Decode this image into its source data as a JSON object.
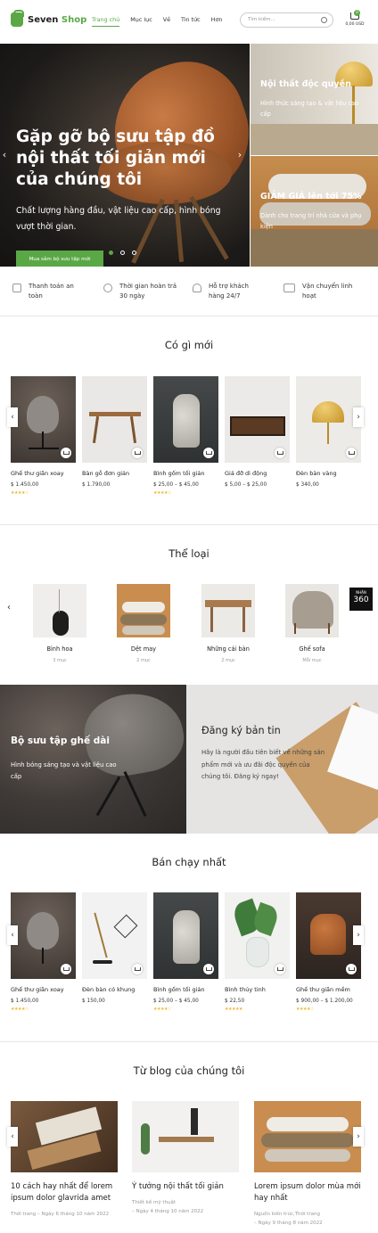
{
  "header": {
    "logo_main": "Seven",
    "logo_accent": "Shop",
    "nav": [
      "Trang chủ",
      "Mục lục",
      "Về",
      "Tin tức",
      "Hơn"
    ],
    "search_placeholder": "Tìm kiếm...",
    "cart_count": "0",
    "cart_total": "0,00 USD"
  },
  "hero": {
    "title": "Gặp gỡ bộ sưu tập đồ nội thất tối giản mới của chúng tôi",
    "subtitle": "Chất lượng hàng đầu, vật liệu cao cấp, hình bóng vượt thời gian.",
    "button": "Mua sắm bộ sưu tập mới",
    "prev": "‹",
    "next": "›"
  },
  "side_banners": [
    {
      "title": "Nội thất độc quyền",
      "subtitle": "Hình thức sáng tạo & vật liệu cao cấp"
    },
    {
      "title": "GIẢM GIÁ lên tới 75%",
      "subtitle": "Dành cho trang trí nhà cửa và phụ kiện"
    }
  ],
  "features": [
    {
      "icon": "payment-icon",
      "text": "Thanh toán an toàn"
    },
    {
      "icon": "return-icon",
      "text": "Thời gian hoàn trả 30 ngày"
    },
    {
      "icon": "support-icon",
      "text": "Hỗ trợ khách hàng 24/7"
    },
    {
      "icon": "truck-icon",
      "text": "Vận chuyển linh hoạt"
    }
  ],
  "new_section": {
    "title": "Có gì mới",
    "products": [
      {
        "name": "Ghế thư giãn xoay",
        "price": "$ 1.450,00",
        "rating": 4
      },
      {
        "name": "Bàn gỗ đơn giản",
        "price": "$ 1.790,00",
        "rating": 0
      },
      {
        "name": "Bình gốm tối giản",
        "price": "$ 25,00 – $ 45,00",
        "rating": 4
      },
      {
        "name": "Giá đỡ di động",
        "price": "$ 5,00 – $ 25,00",
        "rating": 0
      },
      {
        "name": "Đèn bàn vàng",
        "price": "$ 340,00",
        "rating": 0
      }
    ]
  },
  "categories_section": {
    "title": "Thể loại",
    "items": [
      {
        "name": "Bình hoa",
        "count": "3 mục"
      },
      {
        "name": "Dệt may",
        "count": "2 mục"
      },
      {
        "name": "Những cái bàn",
        "count": "2 mục"
      },
      {
        "name": "Ghế sofa",
        "count": "Mỗi mục"
      }
    ],
    "badge_line1": "NHẬN",
    "badge_line2": "360"
  },
  "promo": {
    "title": "Bộ sưu tập ghế dài",
    "subtitle": "Hình bóng sáng tạo và vật liệu cao cấp"
  },
  "newsletter": {
    "title": "Đăng ký bản tin",
    "text": "Hãy là người đầu tiên biết về những sản phẩm mới và ưu đãi độc quyền của chúng tôi. Đăng ký ngay!"
  },
  "bestsellers": {
    "title": "Bán chạy nhất",
    "products": [
      {
        "name": "Ghế thư giãn xoay",
        "price": "$ 1.450,00",
        "rating": 4
      },
      {
        "name": "Đèn bàn có khung",
        "price": "$ 150,00",
        "rating": 0
      },
      {
        "name": "Bình gốm tối giản",
        "price": "$ 25,00 – $ 45,00",
        "rating": 4
      },
      {
        "name": "Bình thủy tinh",
        "price": "$ 22,50",
        "rating": 5
      },
      {
        "name": "Ghế thư giãn mềm",
        "price": "$ 900,00 – $ 1.200,00",
        "rating": 4
      }
    ]
  },
  "blog": {
    "title": "Từ blog của chúng tôi",
    "posts": [
      {
        "title": "10 cách hay nhất để lorem ipsum dolor glavrida amet",
        "category": "Thời trang",
        "date": "– Ngày 6 tháng 10 năm 2022"
      },
      {
        "title": "Ý tưởng nội thất tối giản",
        "category": "Thiết kế mỹ thuật",
        "date": "– Ngày 4 tháng 10 năm 2022"
      },
      {
        "title": "Lorem ipsum dolor mùa mới hay nhất",
        "category": "Nguồn kiến trúc,Thời trang",
        "date": "– Ngày 9 tháng 8 năm 2022"
      }
    ]
  },
  "colors": {
    "accent": "#5aa845",
    "star": "#f0b429"
  }
}
